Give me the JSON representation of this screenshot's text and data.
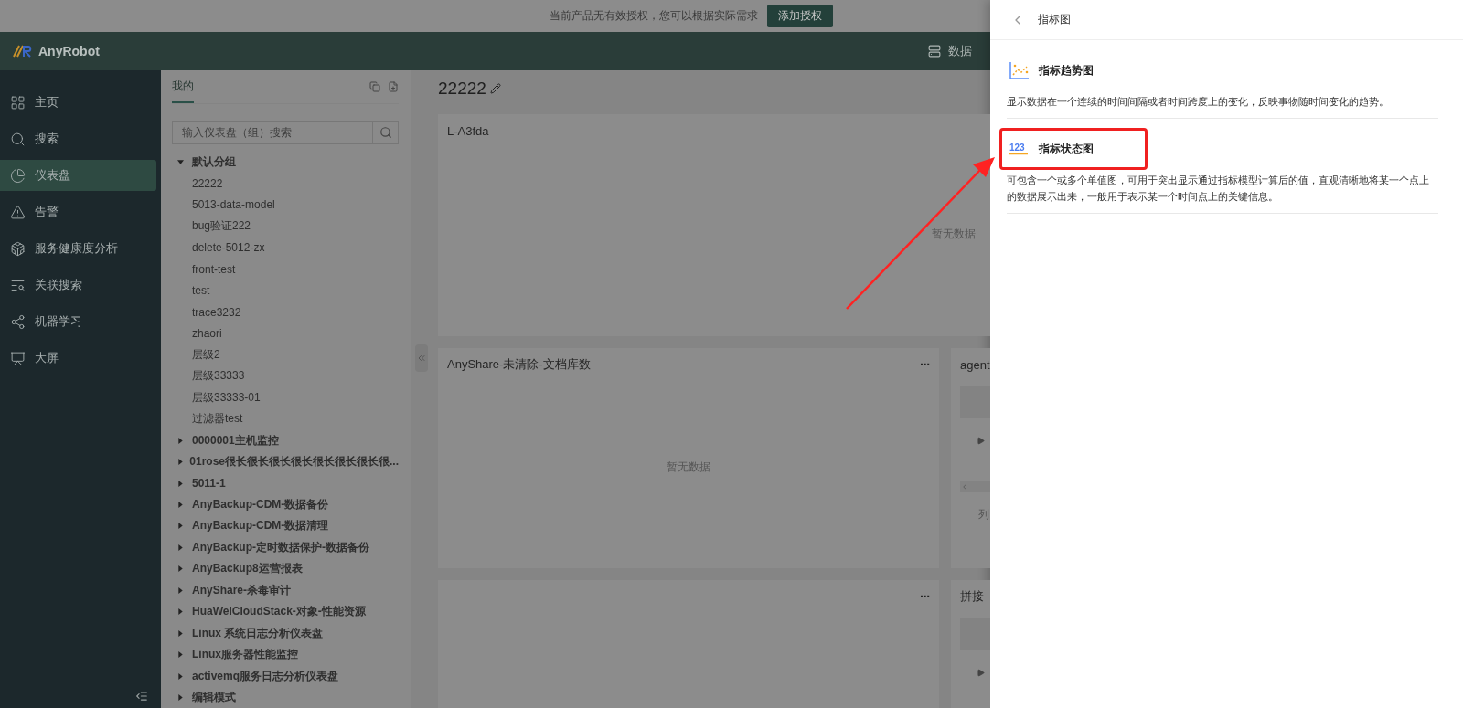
{
  "banner": {
    "text": "当前产品无有效授权，您可以根据实际需求",
    "button": "添加授权"
  },
  "header": {
    "logo": "AnyRobot",
    "right_item": "数据"
  },
  "nav": {
    "items": [
      {
        "label": "主页",
        "selected": false
      },
      {
        "label": "搜索",
        "selected": false
      },
      {
        "label": "仪表盘",
        "selected": true
      },
      {
        "label": "告警",
        "selected": false
      },
      {
        "label": "服务健康度分析",
        "selected": false
      },
      {
        "label": "关联搜索",
        "selected": false
      },
      {
        "label": "机器学习",
        "selected": false
      },
      {
        "label": "大屏",
        "selected": false
      }
    ]
  },
  "tree": {
    "tab": "我的",
    "search": {
      "placeholder": "输入仪表盘（组）搜索"
    },
    "groups": [
      {
        "label": "默认分组",
        "expanded": true,
        "children": [
          {
            "label": "22222"
          },
          {
            "label": "5013-data-model"
          },
          {
            "label": "bug验证222"
          },
          {
            "label": "delete-5012-zx"
          },
          {
            "label": "front-test"
          },
          {
            "label": "test"
          },
          {
            "label": "trace3232"
          },
          {
            "label": "zhaori"
          },
          {
            "label": "层级2"
          },
          {
            "label": "层级33333"
          },
          {
            "label": "层级33333-01"
          },
          {
            "label": "过滤器test"
          }
        ]
      },
      {
        "label": "0000001主机监控",
        "expanded": false
      },
      {
        "label": "01rose很长很长很长很长很长很长很长很...",
        "expanded": false
      },
      {
        "label": "5011-1",
        "expanded": false
      },
      {
        "label": "AnyBackup-CDM-数据备份",
        "expanded": false
      },
      {
        "label": "AnyBackup-CDM-数据清理",
        "expanded": false
      },
      {
        "label": "AnyBackup-定时数据保护-数据备份",
        "expanded": false
      },
      {
        "label": "AnyBackup8运营报表",
        "expanded": false
      },
      {
        "label": "AnyShare-杀毒审计",
        "expanded": false
      },
      {
        "label": "HuaWeiCloudStack-对象-性能资源",
        "expanded": false
      },
      {
        "label": "Linux 系统日志分析仪表盘",
        "expanded": false
      },
      {
        "label": "Linux服务器性能监控",
        "expanded": false
      },
      {
        "label": "activemq服务日志分析仪表盘",
        "expanded": false
      },
      {
        "label": "编辑模式",
        "expanded": false
      }
    ]
  },
  "dashboard": {
    "title": "22222",
    "cards": [
      {
        "kind": "empty",
        "title": "L-A3fda",
        "empty_text": "暂无数据",
        "wide": true
      },
      {
        "kind": "empty",
        "title": "AnyShare-未清除-文档库数",
        "empty_text": "暂无数据",
        "menu": "···"
      },
      {
        "kind": "table",
        "title": "agent",
        "footer": "列"
      },
      {
        "kind": "empty",
        "menu": "···"
      },
      {
        "kind": "table",
        "title": "拼接"
      }
    ]
  },
  "drawer": {
    "title": "指标图",
    "items": [
      {
        "kind": "trend",
        "title": "指标趋势图",
        "description": "显示数据在一个连续的时间间隔或者时间跨度上的变化，反映事物随时间变化的趋势。",
        "highlighted": false
      },
      {
        "kind": "status",
        "icon_text": "123",
        "title": "指标状态图",
        "description": "可包含一个或多个单值图，可用于突出显示通过指标模型计算后的值，直观清晰地将某一个点上的数据展示出来，一般用于表示某一个时间点上的关键信息。",
        "highlighted": true
      }
    ]
  }
}
